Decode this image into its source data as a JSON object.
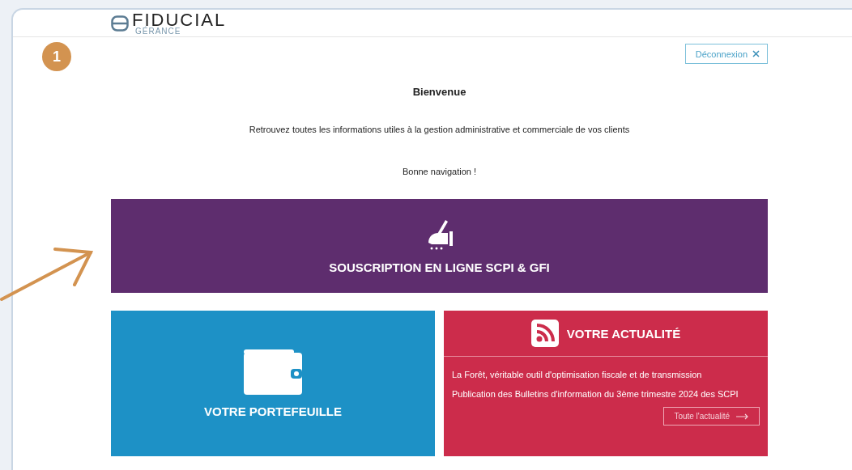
{
  "logo": {
    "name": "FIDUCIAL",
    "subtitle": "GÉRANCE"
  },
  "step_badge": "1",
  "logout_button": {
    "label": "Déconnexion"
  },
  "welcome": {
    "title": "Bienvenue",
    "text": "Retrouvez toutes les informations utiles à la gestion administrative et commerciale de vos clients",
    "closing": "Bonne navigation !"
  },
  "subscription_banner": {
    "label": "SOUSCRIPTION EN LIGNE SCPI & GFI"
  },
  "portfolio_card": {
    "label": "VOTRE PORTEFEUILLE"
  },
  "news_card": {
    "title": "VOTRE ACTUALITÉ",
    "items": [
      "La Forêt, véritable outil d'optimisation fiscale et de transmission",
      "Publication des Bulletins d'information du 3ème trimestre 2024 des SCPI"
    ],
    "more_button": "Toute l'actualité"
  }
}
